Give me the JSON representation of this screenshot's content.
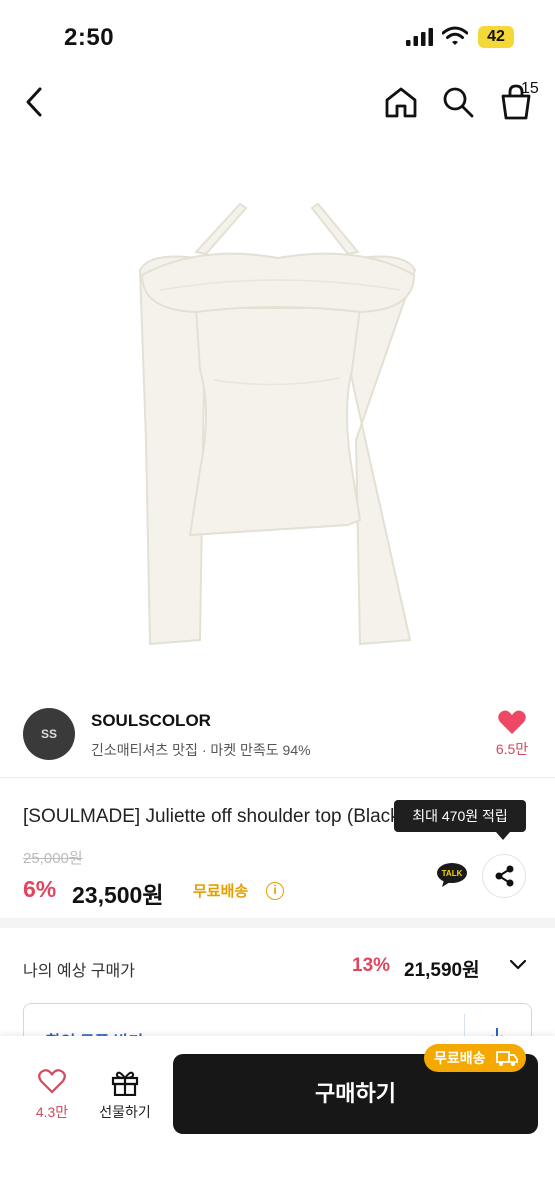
{
  "status_bar": {
    "time": "2:50",
    "battery": "42",
    "battery_color": "#f4d838"
  },
  "nav": {
    "back_icon": "chevron-left-icon",
    "home_icon": "home-icon",
    "search_icon": "search-icon",
    "cart_icon": "shopping-bag-icon",
    "cart_count": "15",
    "badge_color": "#f2607a"
  },
  "store": {
    "logo_text": "SS",
    "name": "SOULSCOLOR",
    "description": "긴소매티셔츠 맛집 · 마켓 만족도 94%",
    "like_count": "6.5만"
  },
  "product": {
    "title": "[SOULMADE] Juliette off shoulder top (Black)",
    "original_price": "25,000원",
    "discount": "6%",
    "price": "23,500원",
    "free_shipping": "무료배송",
    "tooltip": "최대 470원 적립",
    "talk_label": "TALK",
    "accent_color": "#e2455f",
    "shipping_color": "#e5a000"
  },
  "expected_price": {
    "label": "나의 예상 구매가",
    "discount": "13%",
    "value": "21,590원"
  },
  "coupon": {
    "label": "할인 쿠폰 받기"
  },
  "bottom_bar": {
    "favorite_count": "4.3만",
    "gift_label": "선물하기",
    "buy_label": "구매하기",
    "shipping_badge": "무료배송"
  }
}
